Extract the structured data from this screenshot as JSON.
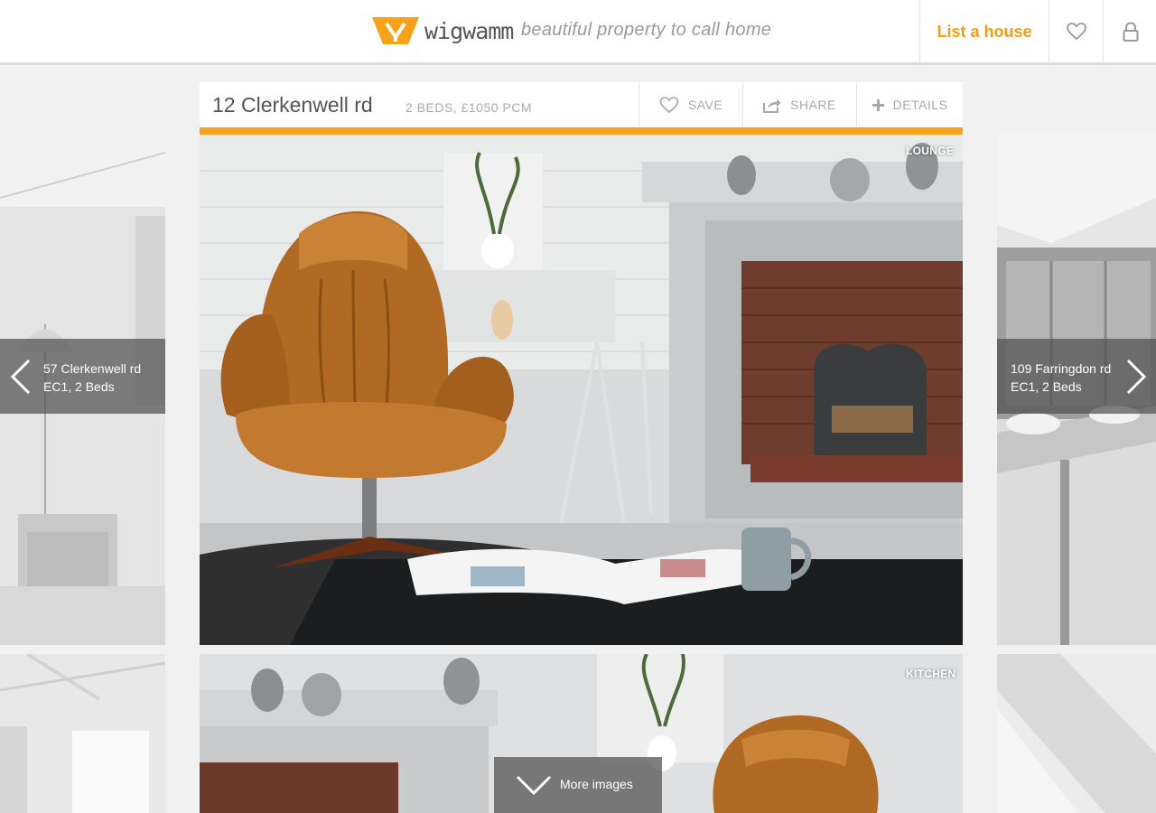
{
  "brand": {
    "name": "wigwamm",
    "tagline": "beautiful property to call home",
    "accent_color": "#f7a21a",
    "logo_icon": "logo-w-mark"
  },
  "header": {
    "list_house_label": "List a house",
    "favorites_icon": "heart-outline-icon",
    "account_icon": "lock-icon"
  },
  "listing": {
    "name": "12 Clerkenwell rd",
    "meta": "2 BEDS, £1050 PCM",
    "actions": {
      "save": "SAVE",
      "share": "SHARE",
      "details": "DETAILS"
    }
  },
  "gallery": {
    "images": [
      {
        "label": "LOUNGE"
      },
      {
        "label": "KITCHEN"
      }
    ],
    "more_images_label": "More images"
  },
  "prev_listing": {
    "line1": "57 Clerkenwell rd",
    "line2": "EC1, 2 Beds"
  },
  "next_listing": {
    "line1": "109 Farringdon rd",
    "line2": "EC1, 2 Beds"
  }
}
